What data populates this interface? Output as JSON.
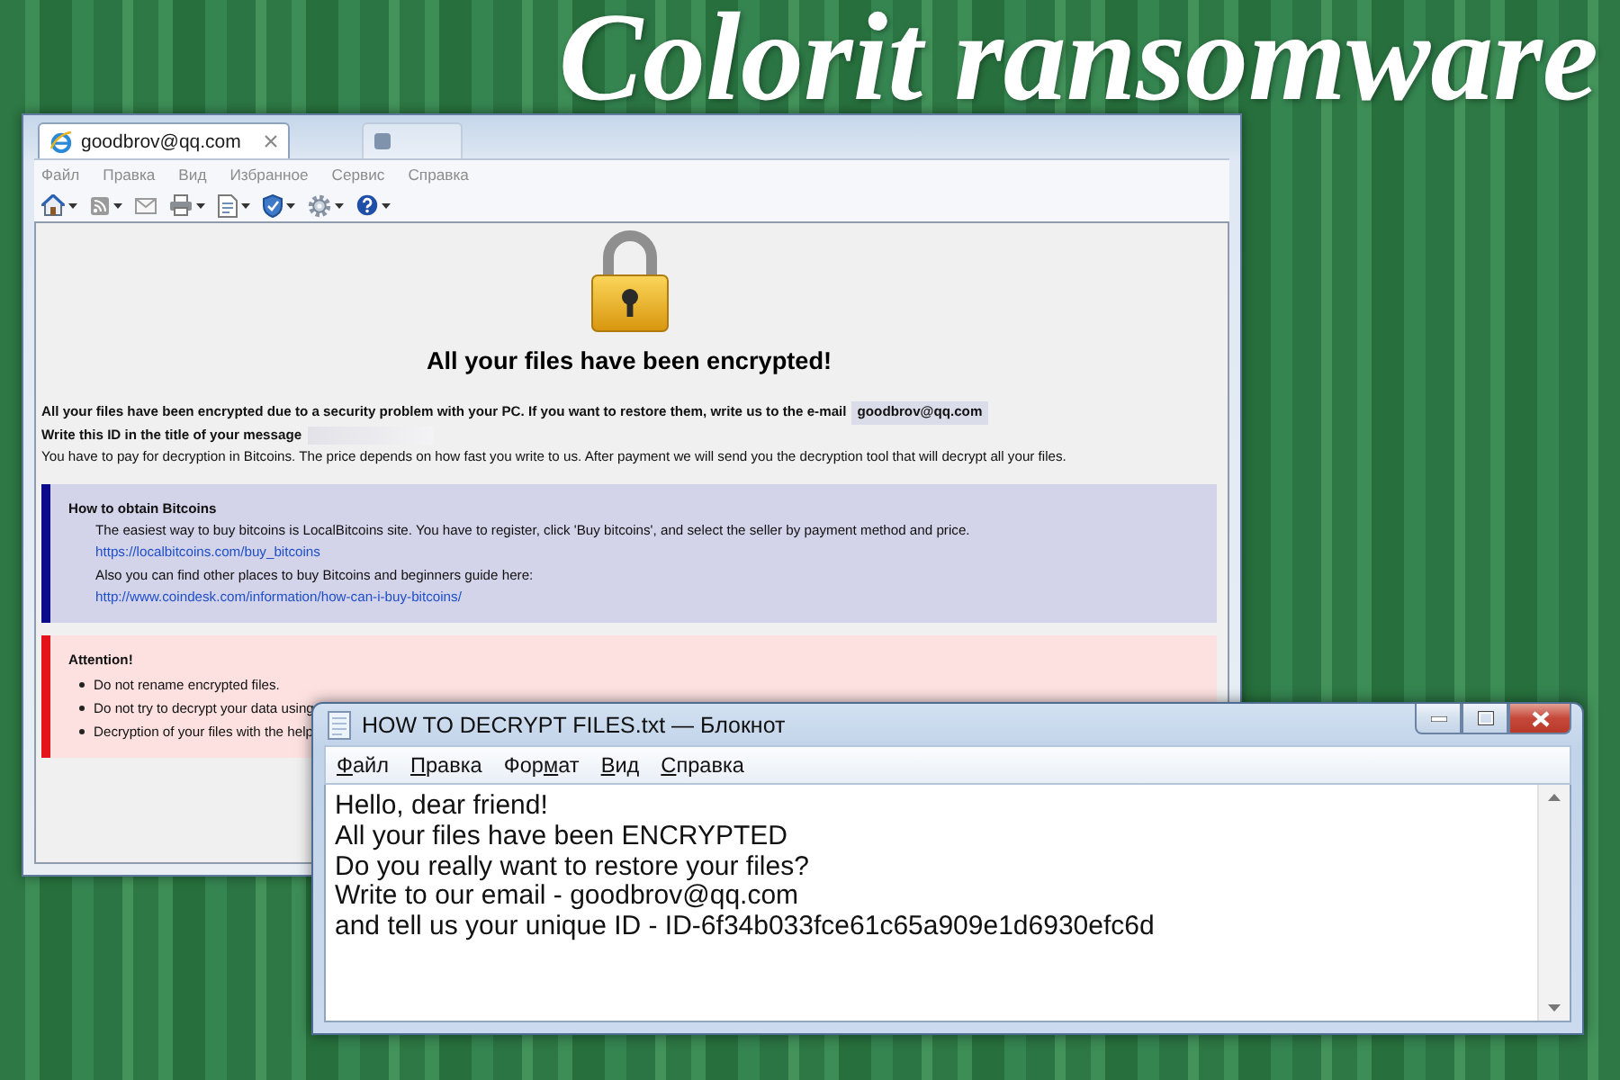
{
  "headline": "Colorit ransomware",
  "browser": {
    "tabs": [
      {
        "label": "goodbrov@qq.com",
        "selected": true
      },
      {
        "selected": false
      }
    ],
    "menu": [
      "Файл",
      "Правка",
      "Вид",
      "Избранное",
      "Сервис",
      "Справка"
    ],
    "page": {
      "heading": "All your files have been encrypted!",
      "intro": "All your files have been encrypted due to a security problem with your PC. If you want to restore them, write us to the e-mail",
      "email": "goodbrov@qq.com",
      "id_prompt": "Write this ID in the title of your message",
      "payment_note": "You have to pay for decryption in Bitcoins. The price depends on how fast you write to us. After payment we will send you the decryption tool that will decrypt all your files.",
      "bitcoin_box": {
        "title": "How to obtain Bitcoins",
        "lines": [
          {
            "kind": "text",
            "text": "The easiest way to buy bitcoins is LocalBitcoins site. You have to register, click 'Buy bitcoins', and select the seller by payment method and price."
          },
          {
            "kind": "link",
            "text": "https://localbitcoins.com/buy_bitcoins"
          },
          {
            "kind": "text",
            "text": "Also you can find other places to buy Bitcoins and beginners guide here:"
          },
          {
            "kind": "link",
            "text": "http://www.coindesk.com/information/how-can-i-buy-bitcoins/"
          }
        ]
      },
      "attention_box": {
        "title": "Attention!",
        "items": [
          "Do not rename encrypted files.",
          "Do not try to decrypt your data using",
          "Decryption of your files with the help"
        ]
      }
    }
  },
  "notepad": {
    "title": "HOW TO DECRYPT FILES.txt — Блокнот",
    "menu": [
      {
        "underlined": "Ф",
        "rest": "айл"
      },
      {
        "underlined": "П",
        "rest": "равка"
      },
      {
        "lead": "Фор",
        "underlined": "м",
        "rest": "ат"
      },
      {
        "underlined": "В",
        "rest": "ид"
      },
      {
        "underlined": "С",
        "rest": "правка"
      }
    ],
    "text": [
      "Hello, dear friend!",
      "All your files have been ENCRYPTED",
      "Do you really want to restore your files?",
      "Write to our email - goodbrov@qq.com",
      "and tell us your unique ID - ID-6f34b033fce61c65a909e1d6930efc6d"
    ]
  }
}
